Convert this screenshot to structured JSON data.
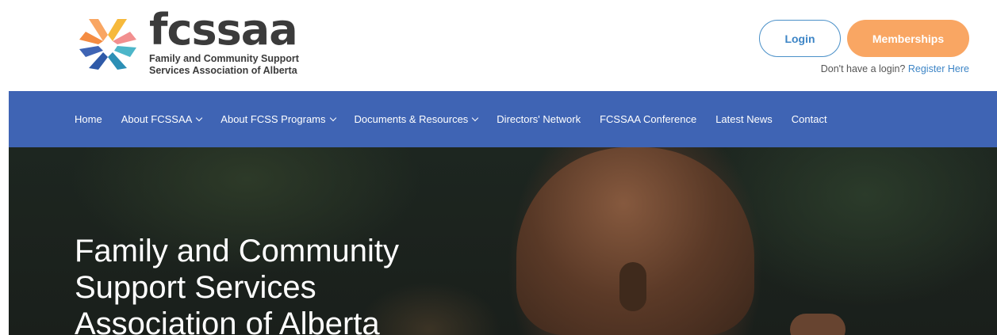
{
  "header": {
    "logo_word": "fcssaa",
    "logo_tagline_1": "Family and Community Support",
    "logo_tagline_2": "Services Association of Alberta",
    "login_label": "Login",
    "memberships_label": "Memberships",
    "register_prompt": "Don't have a login?",
    "register_link": "Register Here"
  },
  "nav": {
    "items": [
      {
        "label": "Home",
        "dropdown": false
      },
      {
        "label": "About FCSSAA",
        "dropdown": true
      },
      {
        "label": "About FCSS Programs",
        "dropdown": true
      },
      {
        "label": "Documents & Resources",
        "dropdown": true
      },
      {
        "label": "Directors' Network",
        "dropdown": false
      },
      {
        "label": "FCSSAA Conference",
        "dropdown": false
      },
      {
        "label": "Latest News",
        "dropdown": false
      },
      {
        "label": "Contact",
        "dropdown": false
      }
    ]
  },
  "hero": {
    "title_line_1": "Family and Community",
    "title_line_2": "Support Services",
    "title_line_3": "Association of Alberta"
  },
  "colors": {
    "nav_bg": "#3f64b4",
    "accent_orange": "#f9a663",
    "accent_blue": "#3d85c6"
  }
}
